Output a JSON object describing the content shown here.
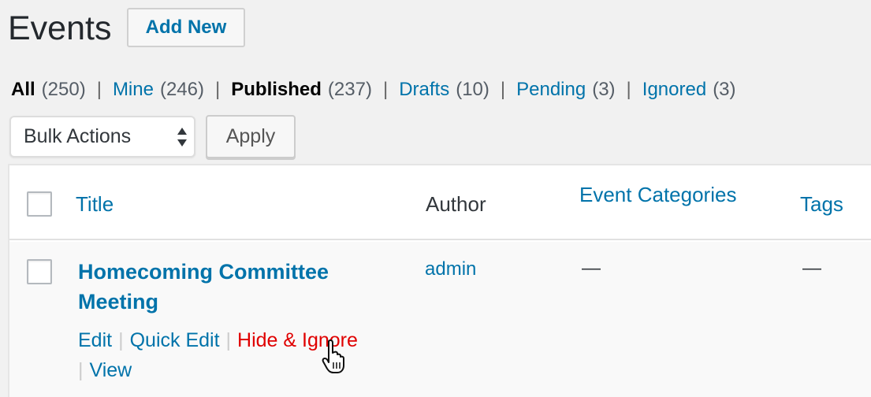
{
  "header": {
    "title": "Events",
    "add_new_label": "Add New"
  },
  "filters": [
    {
      "label": "All",
      "count": "(250)",
      "current": true
    },
    {
      "label": "Mine",
      "count": "(246)",
      "current": false
    },
    {
      "label": "Published",
      "count": "(237)",
      "current": true
    },
    {
      "label": "Drafts",
      "count": "(10)",
      "current": false
    },
    {
      "label": "Pending",
      "count": "(3)",
      "current": false
    },
    {
      "label": "Ignored",
      "count": "(3)",
      "current": false
    }
  ],
  "filter_separator": "|",
  "bulk": {
    "select_value": "Bulk Actions",
    "apply_label": "Apply"
  },
  "table": {
    "columns": {
      "title": "Title",
      "author": "Author",
      "categories": "Event Categories",
      "tags": "Tags"
    },
    "rows": [
      {
        "title_line1": "Homecoming Committee",
        "title_line2": "Meeting",
        "author": "admin",
        "categories": "—",
        "tags": "—",
        "actions": {
          "edit": "Edit",
          "quick_edit": "Quick Edit",
          "hide_ignore": "Hide & Ignore",
          "view": "View",
          "separator": "|"
        }
      }
    ]
  },
  "colors": {
    "link": "#0073aa",
    "danger": "#e00000",
    "background": "#f1f1f1"
  },
  "icons": {
    "select_arrows": "updown-arrows-icon",
    "cursor": "hand-pointer-cursor-icon"
  }
}
